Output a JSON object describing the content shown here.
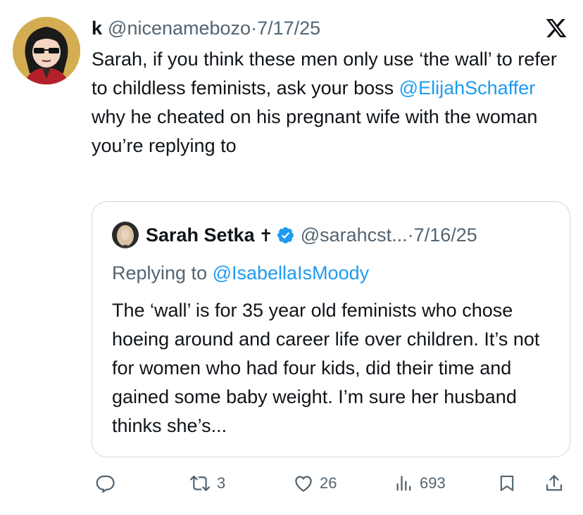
{
  "tweet": {
    "author_name": "k",
    "author_handle": "@nicenamebozo",
    "separator": "·",
    "date": "7/17/25",
    "text_part1": "Sarah, if you think these men only use ‘the wall’ to refer to childless feminists, ask your boss ",
    "mention": "@ElijahSchaffer",
    "text_part2": " why he cheated on his pregnant wife with the woman you’re replying to"
  },
  "quote": {
    "author_name": "Sarah Setka",
    "cross_glyph": "✝",
    "author_handle": "@sarahcst...",
    "separator": "·",
    "date": "7/16/25",
    "replying_prefix": "Replying to ",
    "replying_handle": "@IsabellaIsMoody",
    "text": "The ‘wall’ is for 35 year old feminists who chose hoeing around and career life over children. It’s not for women who had four kids, did their time and gained some baby weight. I’m sure her husband thinks she’s..."
  },
  "actions": {
    "reply_icon": "reply-icon",
    "retweet_count": "3",
    "like_count": "26",
    "views_count": "693",
    "bookmark_icon": "bookmark-icon",
    "share_icon": "share-icon"
  },
  "colors": {
    "link": "#1d9bf0",
    "secondary_text": "#536471",
    "border": "#cfd9de",
    "verified": "#1d9bf0"
  }
}
